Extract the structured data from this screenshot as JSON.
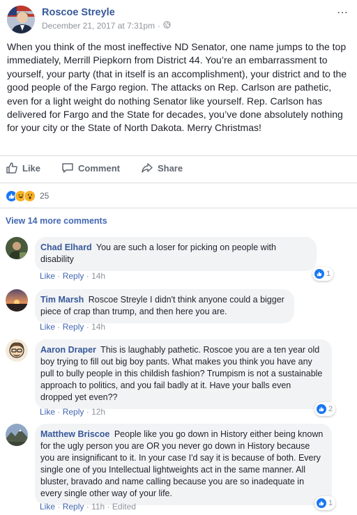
{
  "post": {
    "author": "Roscoe Streyle",
    "timestamp": "December 21, 2017 at 7:31pm",
    "separator": "·",
    "more_icon": "⋯",
    "text": "When you think of the most ineffective ND Senator, one name jumps to the top immediately, Merrill Piepkorn from District 44. You’re an embarrassment to yourself, your party (that in itself is an accomplishment), your district and to the good people of the Fargo region. The attacks on Rep. Carlson are pathetic, even for a light weight do nothing Senator like yourself. Rep. Carlson has delivered for Fargo and the State for decades, you’ve done absolutely nothing for your city or the State of North Dakota. Merry Christmas!"
  },
  "actions": {
    "like": "Like",
    "comment": "Comment",
    "share": "Share"
  },
  "reactions": {
    "count": "25",
    "types": [
      "like",
      "haha",
      "wow"
    ]
  },
  "view_more": "View 14 more comments",
  "comments": [
    {
      "name": "Chad Elhard",
      "text": "You are such a loser for picking on people with disability",
      "like": "Like",
      "dot": "·",
      "reply": "Reply",
      "time": "14h",
      "reactions": "1"
    },
    {
      "name": "Tim Marsh",
      "text": "Roscoe Streyle I didn't think anyone could a bigger piece of crap than trump, and then here you are.",
      "like": "Like",
      "dot": "·",
      "reply": "Reply",
      "time": "14h"
    },
    {
      "name": "Aaron Draper",
      "text": "This is laughably pathetic. Roscoe you are a ten year old boy trying to fill out big boy pants. What makes you think you have any pull to bully people in this childish fashion? Trumpism is not a sustainable approach to politics, and you fail badly at it. Have your balls even dropped yet even??",
      "like": "Like",
      "dot": "·",
      "reply": "Reply",
      "time": "12h",
      "reactions": "2"
    },
    {
      "name": "Matthew Briscoe",
      "text": "People like you go down in History either being known for the ugly person you are OR you never go down in History because you are insignificant to it. In your case I'd say it is because of both. Every single one of you Intellectual lightweights act in the same manner. All bluster, bravado and name calling because you are so inadequate in every single other way of your life.",
      "like": "Like",
      "dot": "·",
      "reply": "Reply",
      "time": "11h",
      "edited": "Edited",
      "reactions": "1"
    }
  ],
  "colors": {
    "link": "#365899",
    "accent": "#4267b2",
    "meta": "#90949c",
    "bubble": "#f2f3f5",
    "like_blue": "#1877f2"
  }
}
